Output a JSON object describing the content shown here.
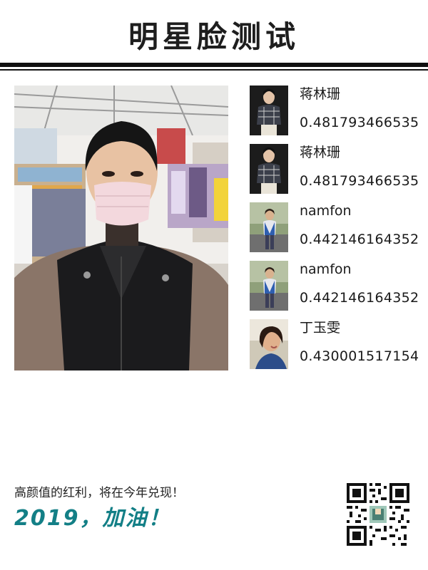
{
  "header": {
    "title": "明星脸测试"
  },
  "results": [
    {
      "name": "蒋林珊",
      "score": "0.481793466535",
      "thumb": "star-photo-1"
    },
    {
      "name": "蒋林珊",
      "score": "0.481793466535",
      "thumb": "star-photo-1"
    },
    {
      "name": "namfon",
      "score": "0.442146164352",
      "thumb": "star-photo-2"
    },
    {
      "name": "namfon",
      "score": "0.442146164352",
      "thumb": "star-photo-2"
    },
    {
      "name": "丁玉雯",
      "score": "0.430001517154",
      "thumb": "star-photo-3"
    }
  ],
  "footer": {
    "tagline": "高颜值的红利，将在今年兑现！",
    "slogan": "2019，加油！"
  },
  "colors": {
    "accent": "#137f86",
    "rule": "#111111"
  }
}
